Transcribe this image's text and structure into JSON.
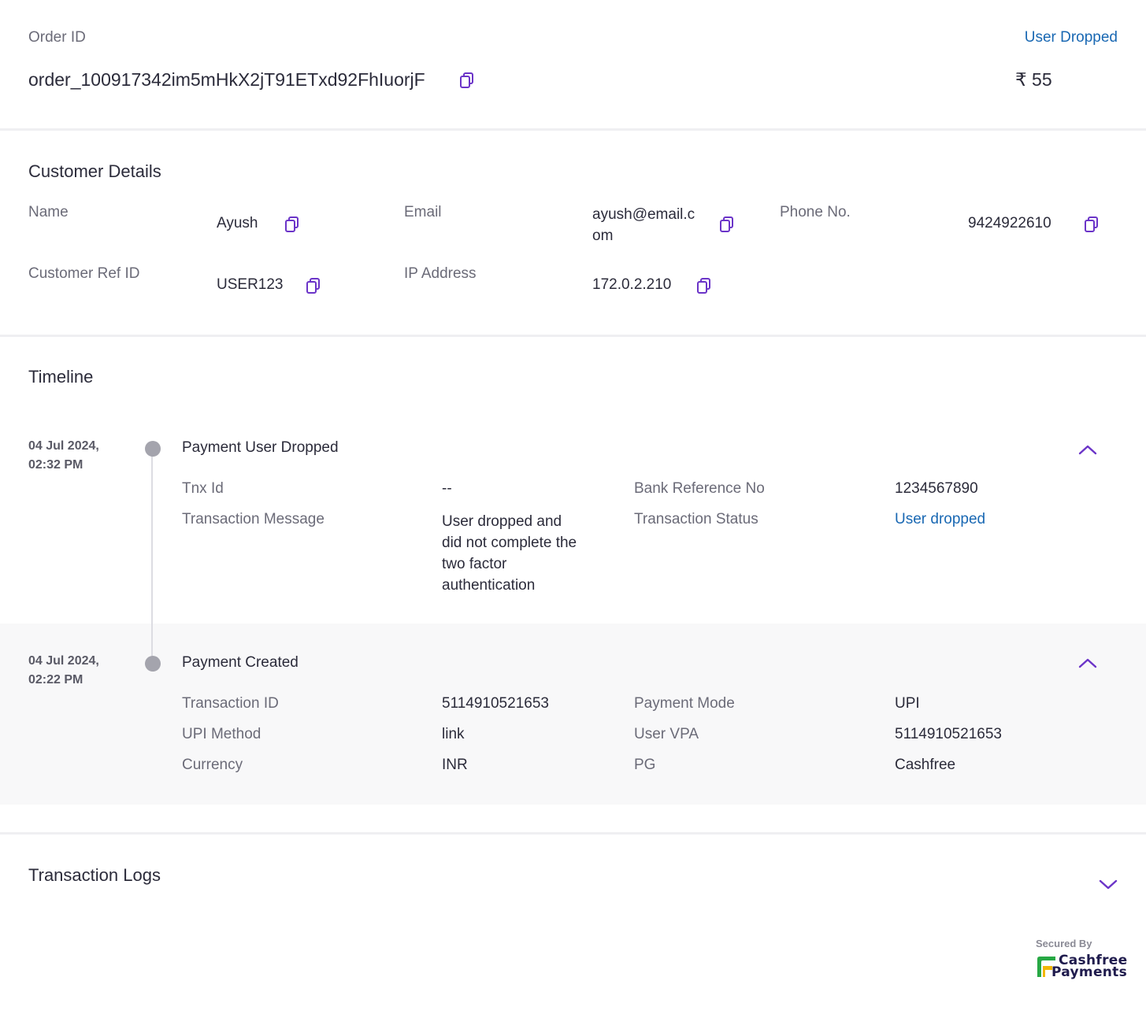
{
  "order": {
    "id_label": "Order ID",
    "id_value": "order_100917342im5mHkX2jT91ETxd92FhIuorjF",
    "status": "User Dropped",
    "amount": "₹ 55"
  },
  "customer": {
    "title": "Customer Details",
    "name_label": "Name",
    "name_value": "Ayush",
    "email_label": "Email",
    "email_value_line1": "ayush@email.c",
    "email_value_line2": "om",
    "phone_label": "Phone No.",
    "phone_value": "9424922610",
    "ref_label": "Customer Ref ID",
    "ref_value": "USER123",
    "ip_label": "IP Address",
    "ip_value": "172.0.2.210"
  },
  "timeline": {
    "title": "Timeline",
    "events": [
      {
        "date_line1": "04 Jul 2024,",
        "date_line2": "02:32 PM",
        "title": "Payment User Dropped",
        "fields": {
          "tnx_label": "Tnx Id",
          "tnx_value": "--",
          "bank_label": "Bank Reference No",
          "bank_value": "1234567890",
          "msg_label": "Transaction Message",
          "msg_line1": "User dropped and",
          "msg_line2": "did not complete the",
          "msg_line3": "two factor",
          "msg_line4": "authentication",
          "status_label": "Transaction Status",
          "status_value": "User dropped"
        }
      },
      {
        "date_line1": "04 Jul 2024,",
        "date_line2": "02:22 PM",
        "title": "Payment Created",
        "fields": {
          "txn_label": "Transaction ID",
          "txn_value": "5114910521653",
          "mode_label": "Payment Mode",
          "mode_value": "UPI",
          "upi_method_label": "UPI Method",
          "upi_method_value": "link",
          "vpa_label": "User VPA",
          "vpa_value": "5114910521653",
          "currency_label": "Currency",
          "currency_value": "INR",
          "pg_label": "PG",
          "pg_value": "Cashfree"
        }
      }
    ]
  },
  "logs": {
    "title": "Transaction Logs"
  },
  "footer": {
    "secured_by": "Secured By",
    "brand_line1": "Cashfree",
    "brand_line2": "Payments"
  },
  "colors": {
    "accent": "#6b34c8",
    "link": "#1968b3",
    "brand_green": "#27a844",
    "brand_yellow": "#f2b705"
  },
  "icons": {
    "copy": "copy-icon",
    "chevron_up": "chevron-up-icon",
    "chevron_down": "chevron-down-icon",
    "brand_logo": "cashfree-logo-icon"
  }
}
